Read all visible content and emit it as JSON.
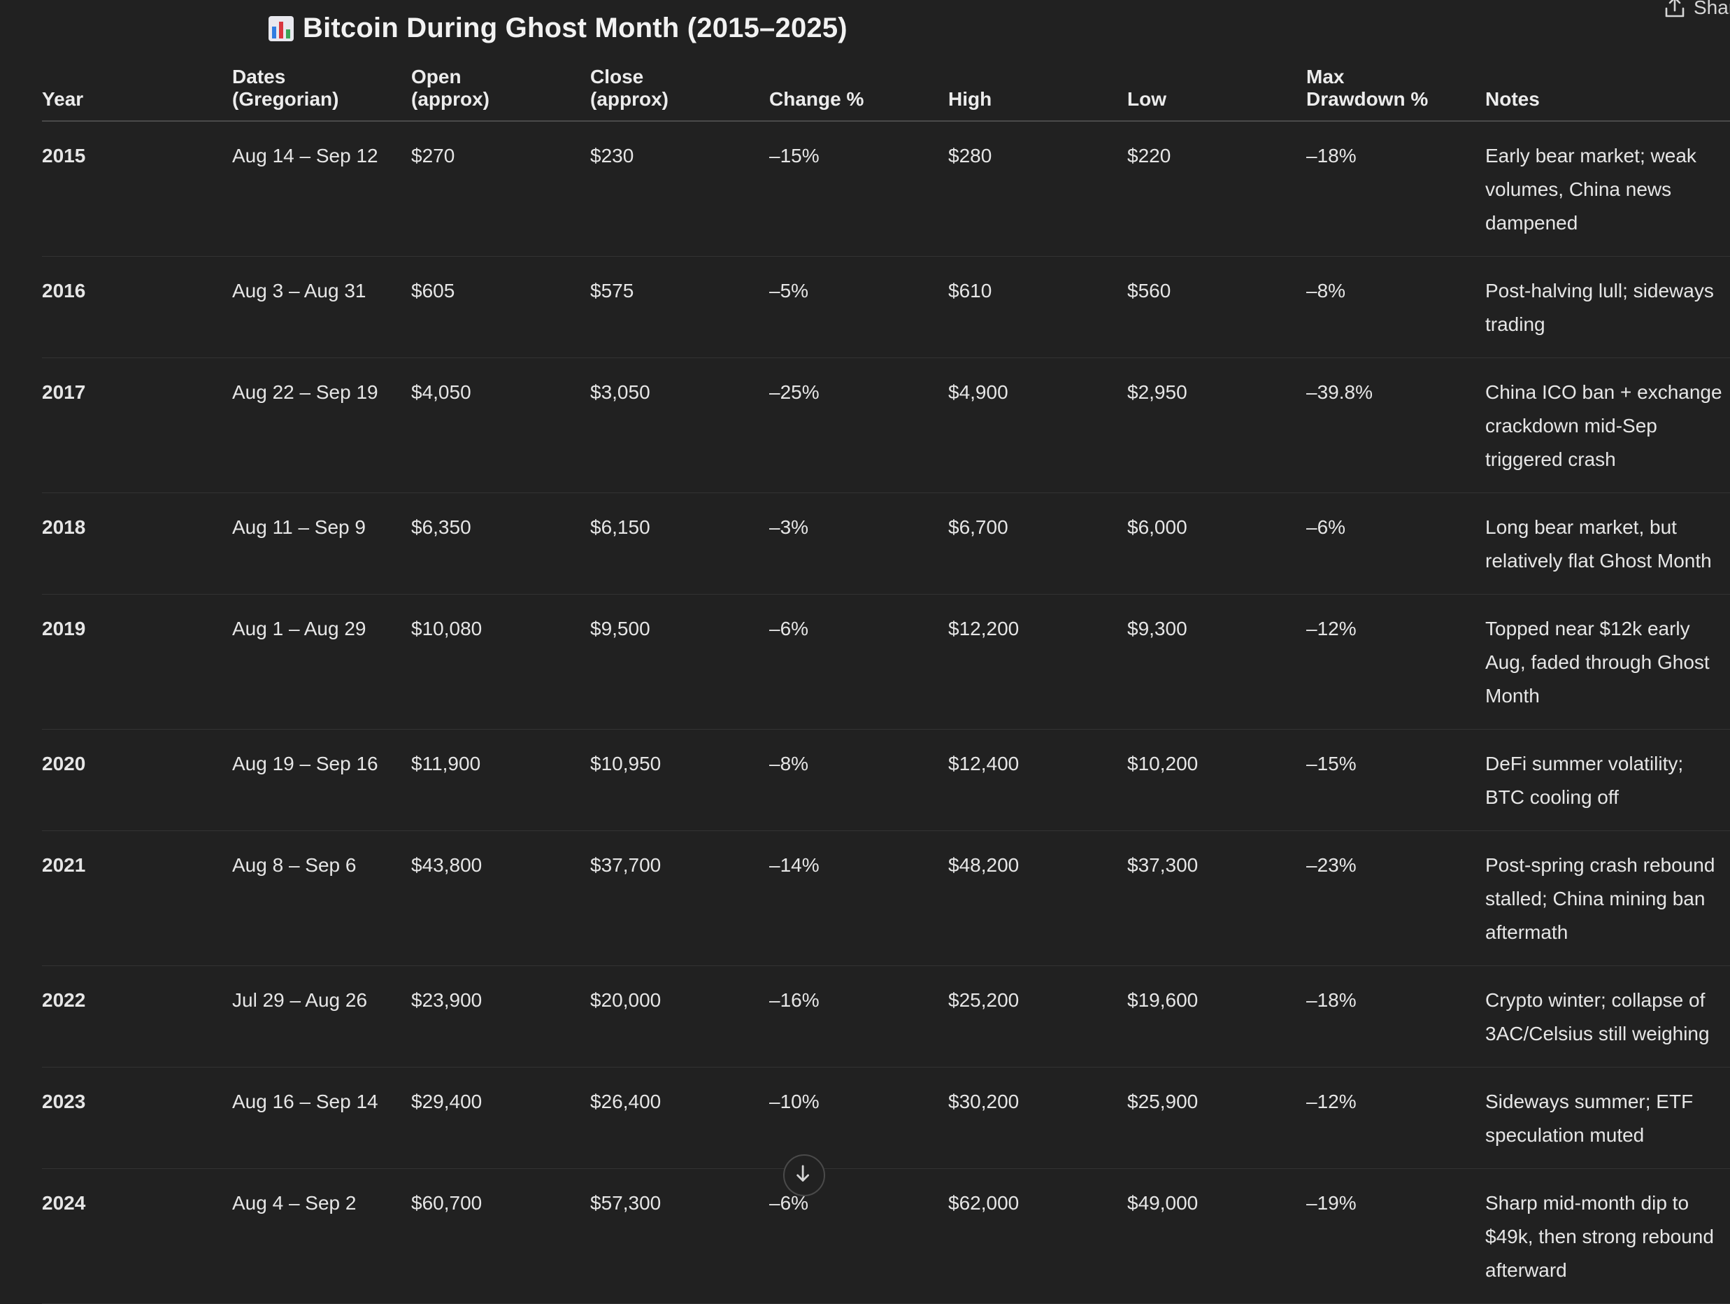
{
  "title": {
    "emoji": "chart-icon",
    "text": "Bitcoin During Ghost Month (2015–2025)"
  },
  "share": {
    "label": "Share",
    "icon": "share-icon"
  },
  "table": {
    "headers": [
      "Year",
      "Dates (Gregorian)",
      "Open (approx)",
      "Close (approx)",
      "Change %",
      "High",
      "Low",
      "Max Drawdown %",
      "Notes"
    ],
    "rows": [
      {
        "year": "2015",
        "dates": "Aug 14 – Sep 12",
        "open": "$270",
        "close": "$230",
        "change": "–15%",
        "high": "$280",
        "low": "$220",
        "drawdown": "–18%",
        "notes": "Early bear market; weak volumes, China news dampened"
      },
      {
        "year": "2016",
        "dates": "Aug 3 – Aug 31",
        "open": "$605",
        "close": "$575",
        "change": "–5%",
        "high": "$610",
        "low": "$560",
        "drawdown": "–8%",
        "notes": "Post-halving lull; sideways trading"
      },
      {
        "year": "2017",
        "dates": "Aug 22 – Sep 19",
        "open": "$4,050",
        "close": "$3,050",
        "change": "–25%",
        "high": "$4,900",
        "low": "$2,950",
        "drawdown": "–39.8%",
        "notes": "China ICO ban + exchange crackdown mid-Sep triggered crash"
      },
      {
        "year": "2018",
        "dates": "Aug 11 – Sep 9",
        "open": "$6,350",
        "close": "$6,150",
        "change": "–3%",
        "high": "$6,700",
        "low": "$6,000",
        "drawdown": "–6%",
        "notes": "Long bear market, but relatively flat Ghost Month"
      },
      {
        "year": "2019",
        "dates": "Aug 1 – Aug 29",
        "open": "$10,080",
        "close": "$9,500",
        "change": "–6%",
        "high": "$12,200",
        "low": "$9,300",
        "drawdown": "–12%",
        "notes": "Topped near $12k early Aug, faded through Ghost Month"
      },
      {
        "year": "2020",
        "dates": "Aug 19 – Sep 16",
        "open": "$11,900",
        "close": "$10,950",
        "change": "–8%",
        "high": "$12,400",
        "low": "$10,200",
        "drawdown": "–15%",
        "notes": "DeFi summer volatility; BTC cooling off"
      },
      {
        "year": "2021",
        "dates": "Aug 8 – Sep 6",
        "open": "$43,800",
        "close": "$37,700",
        "change": "–14%",
        "high": "$48,200",
        "low": "$37,300",
        "drawdown": "–23%",
        "notes": "Post-spring crash rebound stalled; China mining ban aftermath"
      },
      {
        "year": "2022",
        "dates": "Jul 29 – Aug 26",
        "open": "$23,900",
        "close": "$20,000",
        "change": "–16%",
        "high": "$25,200",
        "low": "$19,600",
        "drawdown": "–18%",
        "notes": "Crypto winter; collapse of 3AC/Celsius still weighing"
      },
      {
        "year": "2023",
        "dates": "Aug 16 – Sep 14",
        "open": "$29,400",
        "close": "$26,400",
        "change": "–10%",
        "high": "$30,200",
        "low": "$25,900",
        "drawdown": "–12%",
        "notes": "Sideways summer; ETF speculation muted"
      },
      {
        "year": "2024",
        "dates": "Aug 4 – Sep 2",
        "open": "$60,700",
        "close": "$57,300",
        "change": "–6%",
        "high": "$62,000",
        "low": "$49,000",
        "drawdown": "–19%",
        "notes": "Sharp mid-month dip to $49k, then strong rebound afterward"
      }
    ]
  },
  "scroll_button": {
    "icon": "arrow-down-icon"
  }
}
